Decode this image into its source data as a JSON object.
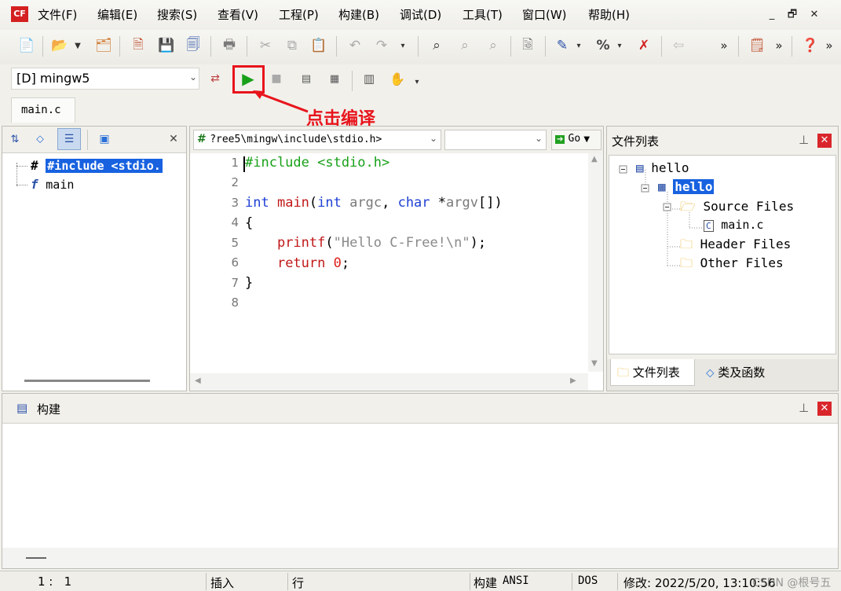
{
  "menu": {
    "app_icon": "cfree-app-icon",
    "items": [
      "文件(F)",
      "编辑(E)",
      "搜索(S)",
      "查看(V)",
      "工程(P)",
      "构建(B)",
      "调试(D)",
      "工具(T)",
      "窗口(W)",
      "帮助(H)"
    ],
    "window_controls": [
      "_",
      "🗗",
      "✕"
    ]
  },
  "toolbar": {
    "compiler_selected": "[D] mingw5",
    "file_tab": "main.c",
    "annotation": "点击编译",
    "annotation_color": "#e8141c"
  },
  "left_panel": {
    "items": [
      {
        "icon": "#",
        "label": "#include <stdio."
      },
      {
        "icon": "f",
        "label": "main"
      }
    ]
  },
  "editor": {
    "path": "?ree5\\mingw\\include\\stdio.h>",
    "go_label": "Go",
    "line_numbers": [
      "1",
      "2",
      "3",
      "4",
      "5",
      "6",
      "7",
      "8"
    ],
    "lines": [
      [
        {
          "t": "#include <stdio.h>",
          "c": "#18a018"
        }
      ],
      [],
      [
        {
          "t": "int",
          "c": "#1d3fd4"
        },
        {
          "t": " ",
          "c": "#000"
        },
        {
          "t": "main",
          "c": "#c01818"
        },
        {
          "t": "(",
          "c": "#000"
        },
        {
          "t": "int",
          "c": "#1d3fd4"
        },
        {
          "t": " ",
          "c": "#000"
        },
        {
          "t": "argc",
          "c": "#7a7a7a"
        },
        {
          "t": ", ",
          "c": "#000"
        },
        {
          "t": "char",
          "c": "#1d3fd4"
        },
        {
          "t": " *",
          "c": "#000"
        },
        {
          "t": "argv",
          "c": "#7a7a7a"
        },
        {
          "t": "[])",
          "c": "#000"
        }
      ],
      [
        {
          "t": "{",
          "c": "#000"
        }
      ],
      [
        {
          "t": "    ",
          "c": "#000"
        },
        {
          "t": "printf",
          "c": "#c01818"
        },
        {
          "t": "(",
          "c": "#000"
        },
        {
          "t": "\"Hello C-Free!\\n\"",
          "c": "#8a8a8a"
        },
        {
          "t": ");",
          "c": "#000"
        }
      ],
      [
        {
          "t": "    ",
          "c": "#000"
        },
        {
          "t": "return",
          "c": "#c01818"
        },
        {
          "t": " ",
          "c": "#000"
        },
        {
          "t": "0",
          "c": "#e0201a"
        },
        {
          "t": ";",
          "c": "#000"
        }
      ],
      [
        {
          "t": "}",
          "c": "#000"
        }
      ],
      []
    ]
  },
  "right_panel": {
    "title": "文件列表",
    "tree": [
      {
        "label": "hello",
        "selected": false
      },
      {
        "label": "hello",
        "selected": true
      },
      {
        "label": "Source Files"
      },
      {
        "label": "main.c"
      },
      {
        "label": "Header Files"
      },
      {
        "label": "Other Files"
      }
    ],
    "tabs": [
      "文件列表",
      "类及函数"
    ]
  },
  "build_panel": {
    "title": "构建"
  },
  "status": {
    "position": "1 :   1",
    "mode": "插入",
    "col": "行",
    "build": "构建",
    "encoding": "ANSI",
    "eol": "DOS",
    "modified": "修改: 2022/5/20, 13:10:56",
    "watermark": "CSDN @根号五"
  }
}
